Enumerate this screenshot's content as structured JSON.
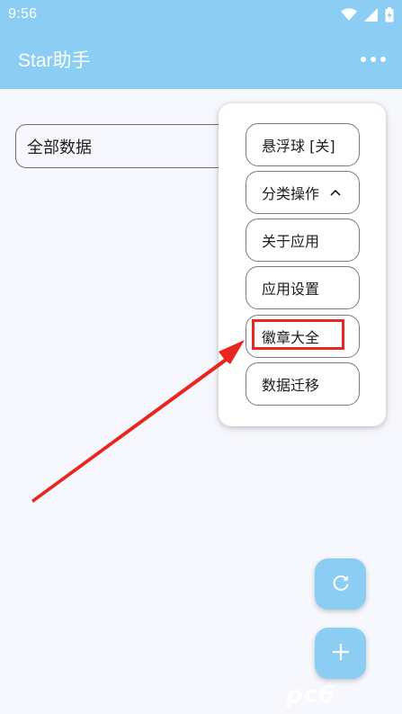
{
  "status_bar": {
    "time": "9:56",
    "icons": [
      "wifi-icon",
      "cellular-signal-icon",
      "battery-charging-icon"
    ]
  },
  "app_bar": {
    "title": "Star助手",
    "more_icon": "more-horizontal-icon"
  },
  "filter": {
    "value": "全部数据"
  },
  "menu": {
    "items": [
      {
        "label": "悬浮球 [关]"
      },
      {
        "label": "分类操作",
        "icon": "chevron-up-icon"
      },
      {
        "label": "关于应用"
      },
      {
        "label": "应用设置"
      },
      {
        "label": "徽章大全",
        "highlighted": true
      },
      {
        "label": "数据迁移"
      }
    ]
  },
  "fabs": {
    "refresh_icon": "refresh-icon",
    "add_icon": "plus-icon"
  },
  "annotation": {
    "color": "#e8261f",
    "target": "徽章大全"
  },
  "watermark": "pc6",
  "colors": {
    "primary": "#8ccdf3",
    "background": "#f7f8fd",
    "annotation_red": "#e8261f"
  }
}
